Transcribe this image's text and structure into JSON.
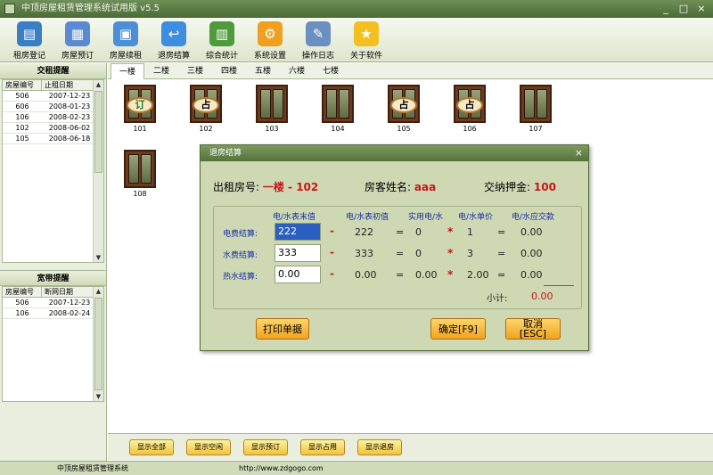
{
  "window": {
    "title": "中顶房屋租赁管理系统试用版 v5.5",
    "min": "_",
    "max": "□",
    "close": "×"
  },
  "toolbar": [
    {
      "label": "租房登记",
      "icon": "register-icon",
      "color": "#3a7fc4"
    },
    {
      "label": "房屋预订",
      "icon": "calendar-icon",
      "color": "#5a8ad2"
    },
    {
      "label": "房屋续租",
      "icon": "renew-icon",
      "color": "#4b8fd8"
    },
    {
      "label": "退房结算",
      "icon": "return-arrow-icon",
      "color": "#3d8ee0"
    },
    {
      "label": "综合统计",
      "icon": "book-icon",
      "color": "#4f9a3a"
    },
    {
      "label": "系统设置",
      "icon": "gear-icon",
      "color": "#f0a020"
    },
    {
      "label": "操作日志",
      "icon": "document-icon",
      "color": "#6a8fc0"
    },
    {
      "label": "关于软件",
      "icon": "star-icon",
      "color": "#f2c020"
    }
  ],
  "rent_panel": {
    "title": "交租提醒",
    "headers": [
      "房屋编号",
      "止租日期"
    ],
    "rows": [
      [
        "506",
        "2007-12-23"
      ],
      [
        "606",
        "2008-01-23"
      ],
      [
        "106",
        "2008-02-23"
      ],
      [
        "102",
        "2008-06-02"
      ],
      [
        "105",
        "2008-06-18"
      ]
    ]
  },
  "net_panel": {
    "title": "宽带提醒",
    "headers": [
      "房屋编号",
      "断网日期"
    ],
    "rows": [
      [
        "506",
        "2007-12-23"
      ],
      [
        "106",
        "2008-02-24"
      ]
    ]
  },
  "tabs": [
    "一楼",
    "二楼",
    "三楼",
    "四楼",
    "五楼",
    "六楼",
    "七楼"
  ],
  "rooms": [
    {
      "num": "101",
      "sign": "订"
    },
    {
      "num": "102",
      "sign": "占"
    },
    {
      "num": "103",
      "sign": ""
    },
    {
      "num": "104",
      "sign": ""
    },
    {
      "num": "105",
      "sign": "占"
    },
    {
      "num": "106",
      "sign": "占"
    },
    {
      "num": "107",
      "sign": ""
    },
    {
      "num": "108",
      "sign": ""
    }
  ],
  "bottom_buttons": [
    "显示全部",
    "显示空闲",
    "显示预订",
    "显示占用",
    "显示退房"
  ],
  "status": {
    "name": "中顶房屋租赁管理系统",
    "url": "http://www.zdgogo.com"
  },
  "dialog": {
    "title": "退房结算",
    "close": "×",
    "room_label": "出租房号:",
    "room_value": "一楼 - 102",
    "guest_label": "房客姓名:",
    "guest_value": "aaa",
    "deposit_label": "交纳押金:",
    "deposit_value": "100",
    "headers": [
      "电/水表末值",
      "电/水表初值",
      "实用电/水",
      "电/水单价",
      "电/水应交款"
    ],
    "rows": [
      {
        "label": "电费结算:",
        "end": "222",
        "start": "222",
        "used": "0",
        "price": "1",
        "due": "0.00"
      },
      {
        "label": "水费结算:",
        "end": "333",
        "start": "333",
        "used": "0",
        "price": "3",
        "due": "0.00"
      },
      {
        "label": "热水结算:",
        "end": "0.00",
        "start": "0.00",
        "used": "0.00",
        "price": "2.00",
        "due": "0.00"
      }
    ],
    "minus": "-",
    "equals": "=",
    "times": "*",
    "subtotal_label": "小计:",
    "subtotal_value": "0.00",
    "print_btn": "打印单据",
    "ok_btn": "确定[F9]",
    "cancel_btn": "取消\n[ESC]"
  }
}
